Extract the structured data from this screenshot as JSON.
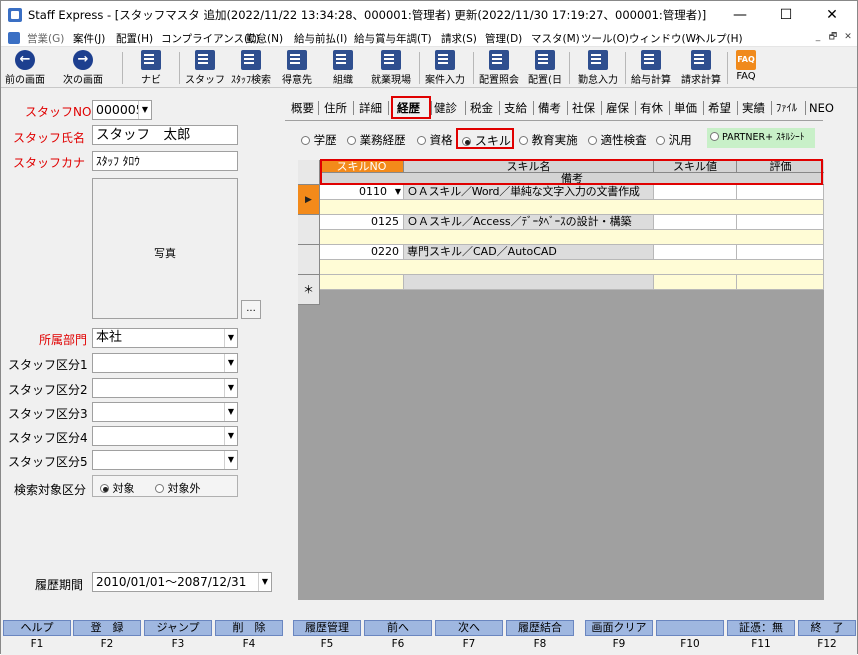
{
  "window": {
    "title": "Staff Express - [スタッフマスタ 追加(2022/11/22 13:34:28、000001:管理者) 更新(2022/11/30 17:19:27、000001:管理者)]",
    "minimize": "—",
    "maximize": "☐",
    "close": "✕"
  },
  "menu": {
    "items": [
      "営業(G)",
      "案件(J)",
      "配置(H)",
      "コンプライアンス(C)",
      "勤怠(N)",
      "給与前払(I)",
      "給与賞与年調(T)",
      "請求(S)",
      "管理(D)",
      "マスタ(M)",
      "ツール(O)",
      "ウィンドウ(W)",
      "ヘルプ(H)"
    ],
    "mdi": [
      "_",
      "🗗",
      "✕"
    ]
  },
  "toolbar": {
    "items": [
      "前の画面",
      "次の画面",
      "ナビ",
      "スタッフ",
      "ｽﾀｯﾌ検索",
      "得意先",
      "組織",
      "就業現場",
      "案件入力",
      "配置照会",
      "配置(日",
      "勤怠入力",
      "給与計算",
      "請求計算",
      "FAQ"
    ],
    "faq_badge": "FAQ"
  },
  "staff": {
    "no_label": "スタッフNO",
    "no_value": "000005",
    "name_label": "スタッフ氏名",
    "name_value": "スタッフ　太郎",
    "kana_label": "スタッフカナ",
    "kana_value": "ｽﾀｯﾌ ﾀﾛｳ",
    "photo_label": "写真",
    "photo_button": "...",
    "dept_label": "所属部門",
    "dept_value": "本社",
    "kubun_labels": [
      "スタッフ区分1",
      "スタッフ区分2",
      "スタッフ区分3",
      "スタッフ区分4",
      "スタッフ区分5"
    ],
    "search_label": "検索対象区分",
    "search_on": "対象",
    "search_off": "対象外",
    "period_label": "履歴期間",
    "period_value": "2010/01/01～2087/12/31"
  },
  "tabs": [
    "概要",
    "住所",
    "詳細",
    "経歴",
    "健診",
    "税金",
    "支給",
    "備考",
    "社保",
    "雇保",
    "有休",
    "単価",
    "希望",
    "実績",
    "ﾌｧｲﾙ",
    "NEO"
  ],
  "history_types": [
    "学歴",
    "業務経歴",
    "資格",
    "スキル",
    "教育実施",
    "適性検査",
    "汎用"
  ],
  "partner_button": "PARTNER+ ｽｷﾙｼｰﾄ",
  "grid": {
    "headers": [
      "スキルNO",
      "スキル名",
      "スキル値",
      "評価"
    ],
    "sub_header": "備考",
    "rows": [
      {
        "no": "0110",
        "name": "ＯＡスキル／Word／単純な文字入力の文書作成"
      },
      {
        "no": "0125",
        "name": "ＯＡスキル／Access／ﾃﾞｰﾀﾍﾞｰｽの設計・構築"
      },
      {
        "no": "0220",
        "name": "専門スキル／CAD／AutoCAD"
      }
    ],
    "new_row_marker": "＊"
  },
  "fkeys": [
    {
      "label": "ヘルプ",
      "key": "F1"
    },
    {
      "label": "登　録",
      "key": "F2"
    },
    {
      "label": "ジャンプ",
      "key": "F3"
    },
    {
      "label": "削　除",
      "key": "F4"
    },
    {
      "label": "履歴管理",
      "key": "F5"
    },
    {
      "label": "前へ",
      "key": "F6"
    },
    {
      "label": "次へ",
      "key": "F7"
    },
    {
      "label": "履歴結合",
      "key": "F8"
    },
    {
      "label": "画面クリア",
      "key": "F9"
    },
    {
      "label": "",
      "key": "F10"
    },
    {
      "label": "証憑：無",
      "key": "F11"
    },
    {
      "label": "終　了",
      "key": "F12"
    }
  ]
}
